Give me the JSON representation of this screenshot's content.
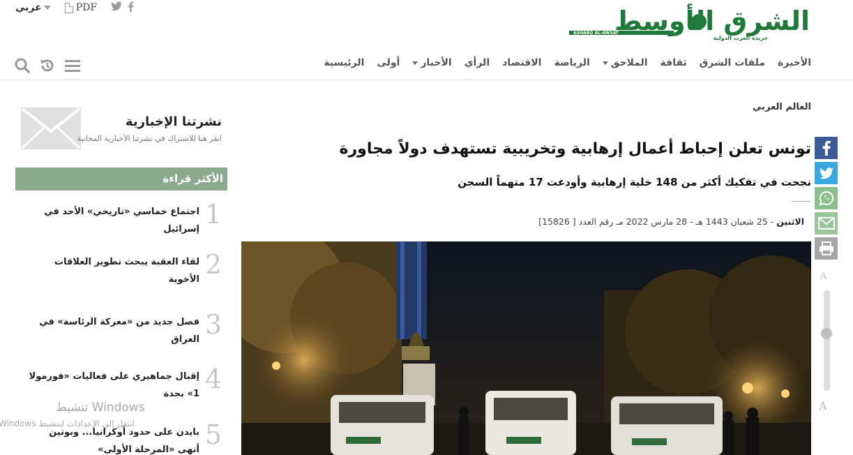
{
  "topbar": {
    "language": "عربي",
    "pdf_label": "PDF",
    "social": [
      "twitter-icon",
      "facebook-icon"
    ]
  },
  "logo": {
    "name": "الشرق الأوسط",
    "subtitle": "جريدة العرب الدولية",
    "latin": "ASHARQ AL-AWSAT"
  },
  "nav": {
    "items": [
      {
        "label": "الرئيسية",
        "dropdown": false
      },
      {
        "label": "أولى",
        "dropdown": false
      },
      {
        "label": "الأخبار",
        "dropdown": true
      },
      {
        "label": "الرأي",
        "dropdown": false
      },
      {
        "label": "الاقتصاد",
        "dropdown": false
      },
      {
        "label": "الرياضة",
        "dropdown": false
      },
      {
        "label": "الملاحق",
        "dropdown": true
      },
      {
        "label": "ثقافة",
        "dropdown": false
      },
      {
        "label": "ملفات الشرق",
        "dropdown": false
      },
      {
        "label": "الأخيرة",
        "dropdown": false
      }
    ],
    "tools": [
      "menu-icon",
      "history-icon",
      "search-icon"
    ]
  },
  "article": {
    "section": "العالم العربي",
    "headline": "تونس تعلن إحباط أعمال إرهابية وتخريبية تستهدف دولاً مجاورة",
    "subheadline": "نجحت في تفكيك أكثر من 148 خلية إرهابية وأودعت 17 متهماً السجن",
    "day": "الاثنين",
    "date": "- 25 شعبان 1443 هـ - 28 مارس 2022 مـ رقم العدد [ 15826]"
  },
  "share": {
    "buttons": [
      {
        "icon": "facebook-icon",
        "color": "#3b5998"
      },
      {
        "icon": "twitter-icon",
        "color": "#3aa8e0"
      },
      {
        "icon": "whatsapp-icon",
        "color": "#8bbf8b"
      },
      {
        "icon": "mail-icon",
        "color": "#9bc49b"
      },
      {
        "icon": "print-icon",
        "color": "#a6a6a6"
      }
    ],
    "font_large": "A",
    "font_small": "A",
    "font_level": 0.43
  },
  "sidebar": {
    "newsletter_title": "نشرتنا الإخبارية",
    "newsletter_sub": "انقر هنا للاشتراك في نشرتنا الأخبارية المجانية",
    "most_read_title": "الأكثر قراءة",
    "most_read": [
      {
        "num": "1",
        "title": "اجتماع خماسي «تاريخي» الأحد في إسرائيل"
      },
      {
        "num": "2",
        "title": "لقاء العقبة يبحث تطوير العلاقات الأخوية"
      },
      {
        "num": "3",
        "title": "فصل جديد من «معركة الرئاسة» في العراق"
      },
      {
        "num": "4",
        "title": "إقبال جماهيري على فعاليات «فورمولا 1» بجدة"
      },
      {
        "num": "5",
        "title": "بايدن على حدود أوكرانيا... وبوتين أنهى «المرحلة الأولى»"
      }
    ]
  },
  "watermark": {
    "line1": "تنشيط Windows",
    "line2": "انتقل إلى الإعدادات لتنشيط Windows"
  },
  "colors": {
    "brand_green": "#1f7a3a",
    "most_read_bg": "#8ba98c"
  }
}
